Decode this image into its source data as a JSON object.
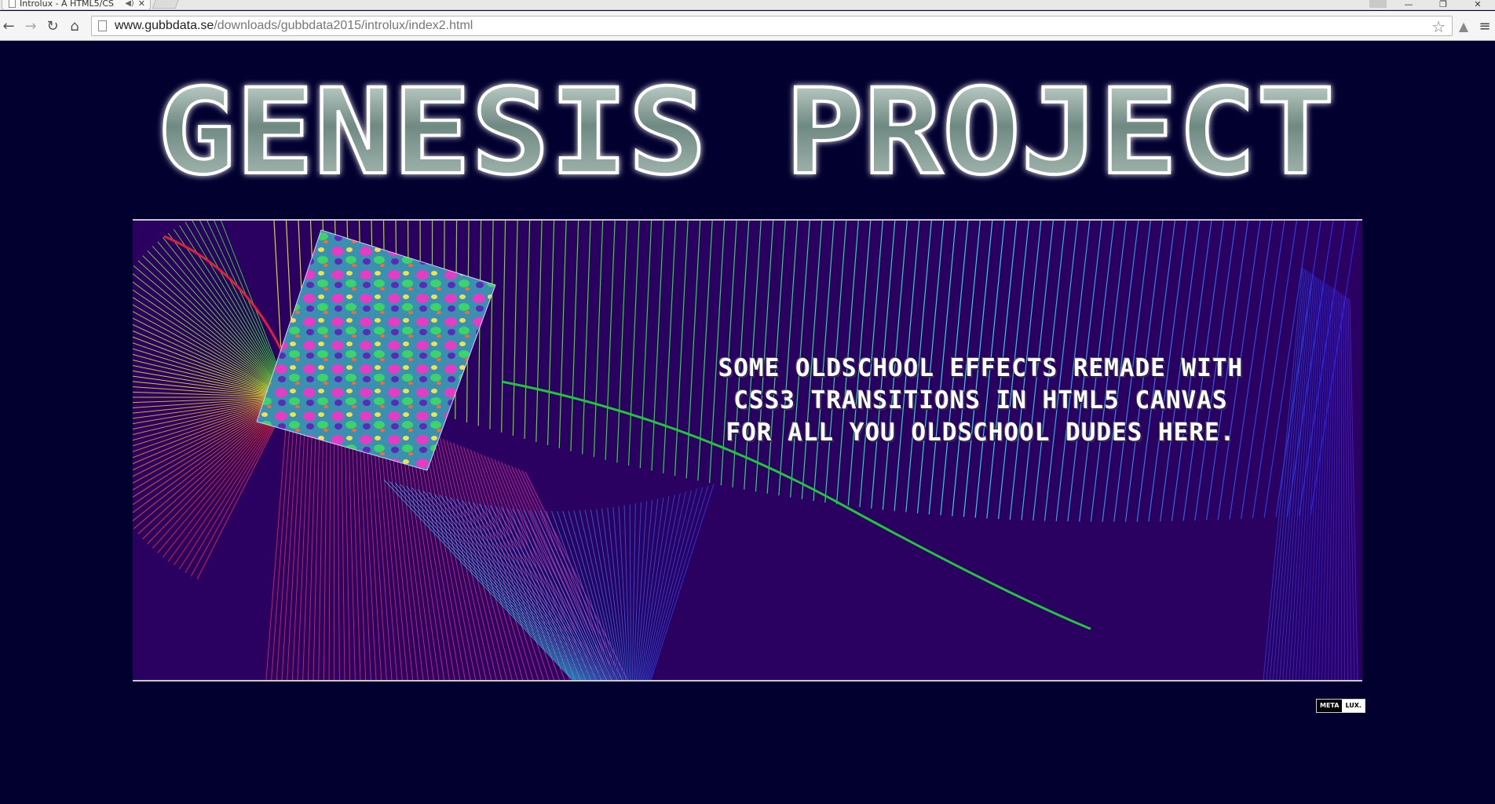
{
  "browser": {
    "tab_title": "Introlux - A HTML5/CS",
    "url_host": "www.gubbdata.se",
    "url_path": "/downloads/gubbdata2015/introlux/index2.html"
  },
  "page": {
    "logo_text": "GENESIS PROJECT",
    "scroller_lines": [
      "SOME OLDSCHOOL EFFECTS REMADE WITH",
      "CSS3 TRANSITIONS IN HTML5 CANVAS",
      "FOR ALL YOU OLDSCHOOL DUDES HERE."
    ],
    "badge_left": "META",
    "badge_right": "LUX."
  },
  "colors": {
    "background": "#02002f",
    "stage": "#2a0060",
    "logo_fill": "#5e7a72"
  }
}
